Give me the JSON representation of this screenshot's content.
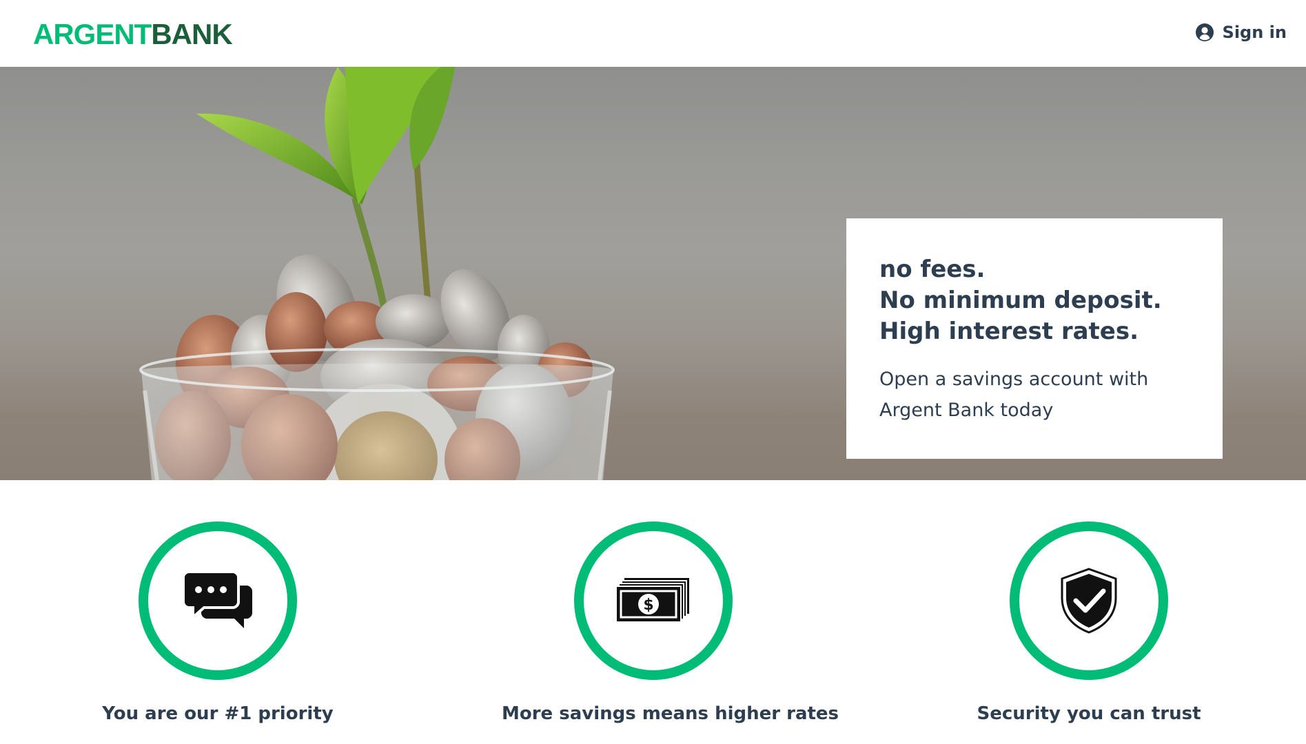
{
  "header": {
    "logo_part1": "ARGENT",
    "logo_part2": "BANK",
    "signin_label": "Sign in",
    "signin_icon": "user-circle-icon"
  },
  "hero": {
    "image": "plant-growing-from-coins-in-glass-jar",
    "promo": {
      "line1": "no fees.",
      "line2": "No minimum deposit.",
      "line3": "High interest rates.",
      "subtitle_line1": "Open a savings account with",
      "subtitle_line2": "Argent Bank today"
    }
  },
  "features": [
    {
      "icon": "chat-bubbles-icon",
      "title": "You are our #1 priority"
    },
    {
      "icon": "money-bills-icon",
      "title": "More savings means higher rates"
    },
    {
      "icon": "shield-check-icon",
      "title": "Security you can trust"
    }
  ],
  "colors": {
    "accent": "#00bc77",
    "brand_dark": "#1a5e3a",
    "text": "#2c3e50"
  }
}
